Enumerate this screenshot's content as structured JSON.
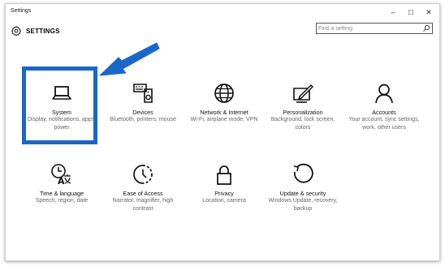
{
  "window": {
    "title": "Settings",
    "controls": {
      "minimize": "–",
      "maximize": "☐",
      "close": "✕"
    }
  },
  "header": {
    "icon": "gear-icon",
    "heading": "SETTINGS",
    "search": {
      "placeholder": "Find a setting",
      "icon": "search-icon"
    }
  },
  "tiles": [
    {
      "name": "System",
      "desc": "Display, notifications, apps, power",
      "icon": "laptop-icon"
    },
    {
      "name": "Devices",
      "desc": "Bluetooth, printers, mouse",
      "icon": "devices-icon"
    },
    {
      "name": "Network & Internet",
      "desc": "Wi-Fi, airplane mode, VPN",
      "icon": "globe-icon"
    },
    {
      "name": "Personalization",
      "desc": "Background, lock screen, colors",
      "icon": "personalization-icon"
    },
    {
      "name": "Accounts",
      "desc": "Your account, sync settings, work, other users",
      "icon": "person-icon"
    },
    {
      "name": "Time & language",
      "desc": "Speech, region, date",
      "icon": "time-language-icon"
    },
    {
      "name": "Ease of Access",
      "desc": "Narrator, magnifier, high contrast",
      "icon": "ease-of-access-icon"
    },
    {
      "name": "Privacy",
      "desc": "Location, camera",
      "icon": "lock-icon"
    },
    {
      "name": "Update & security",
      "desc": "Windows Update, recovery, backup",
      "icon": "update-icon"
    }
  ],
  "colors": {
    "highlight": "#1b66c9",
    "arrow": "#1b66c9"
  }
}
